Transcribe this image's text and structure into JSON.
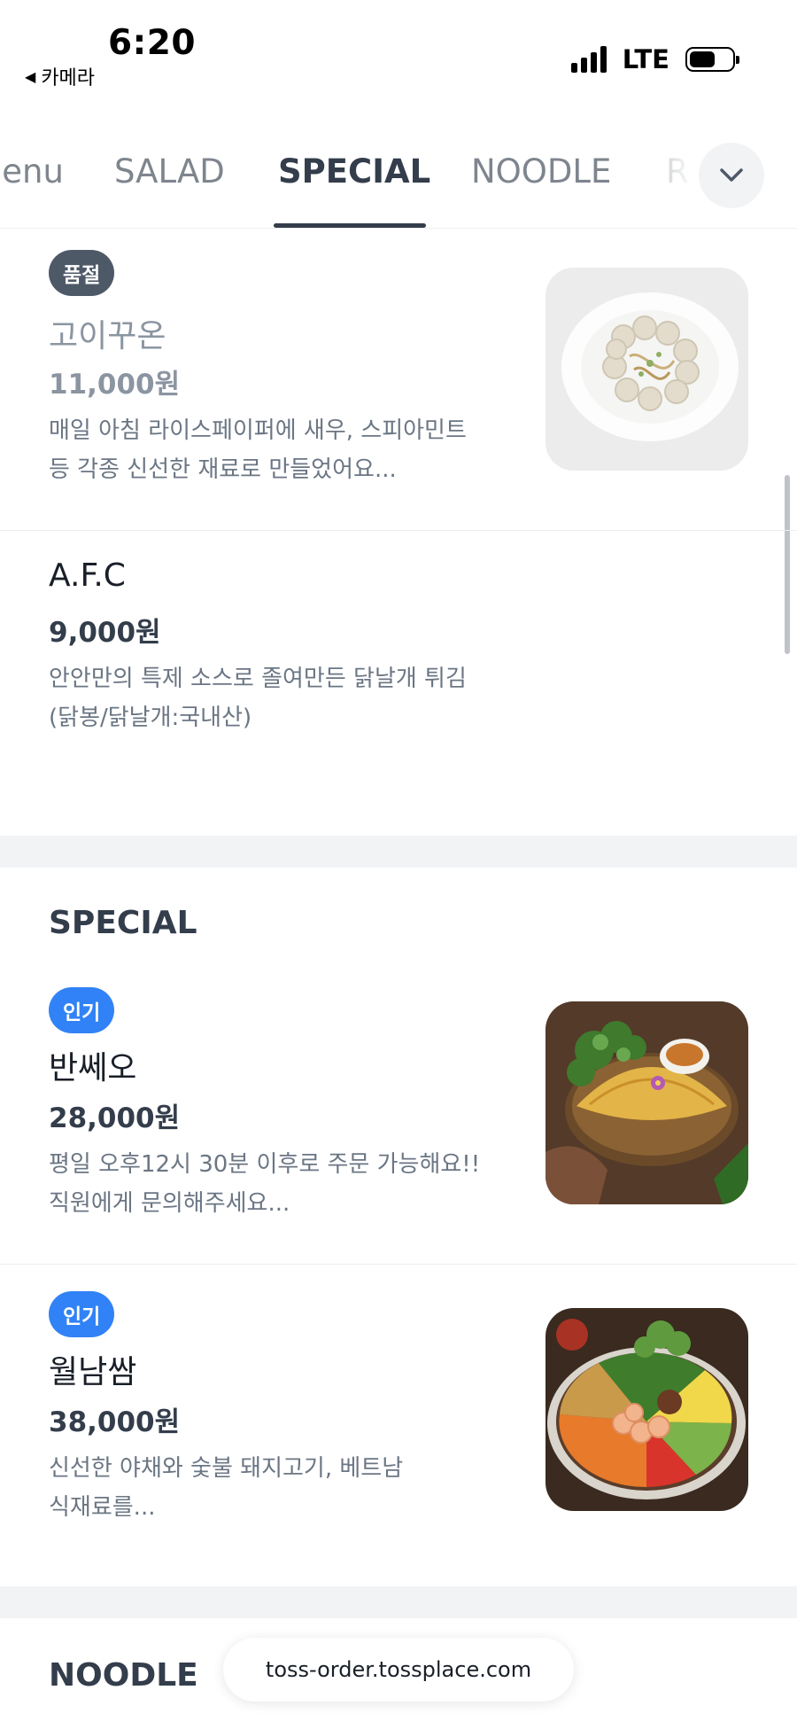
{
  "status_bar": {
    "time": "6:20",
    "back_app": "카메라",
    "network": "LTE"
  },
  "tabs": {
    "items": [
      "lenu",
      "SALAD",
      "SPECIAL",
      "NOODLE",
      "R"
    ],
    "active": "SPECIAL",
    "more_icon": "chevron-down-icon"
  },
  "menu": {
    "items": [
      {
        "badge": "품절",
        "name": "고이꾸온",
        "price": "11,000원",
        "description": "매일 아침 라이스페이퍼에 새우, 스피아민트\n등 각종 신선한 재료로 만들었어요...",
        "image": "goi-cuon-photo"
      },
      {
        "name": "A.F.C",
        "price": "9,000원",
        "description": "안안만의 특제 소스로 졸여만든 닭날개 튀김\n(닭봉/닭날개:국내산)"
      }
    ]
  },
  "special": {
    "title": "SPECIAL",
    "items": [
      {
        "badge": "인기",
        "name": "반쎄오",
        "price": "28,000원",
        "description": "평일 오후12시 30분 이후로 주문 가능해요!!\n직원에게 문의해주세요...",
        "image": "banh-xeo-photo"
      },
      {
        "badge": "인기",
        "name": "월남쌈",
        "price": "38,000원",
        "description": "신선한 야채와 숯불 돼지고기, 베트남\n식재료를...",
        "image": "wollamssam-photo"
      }
    ]
  },
  "noodle": {
    "title": "NOODLE"
  },
  "url_bar": {
    "url": "toss-order.tossplace.com"
  }
}
